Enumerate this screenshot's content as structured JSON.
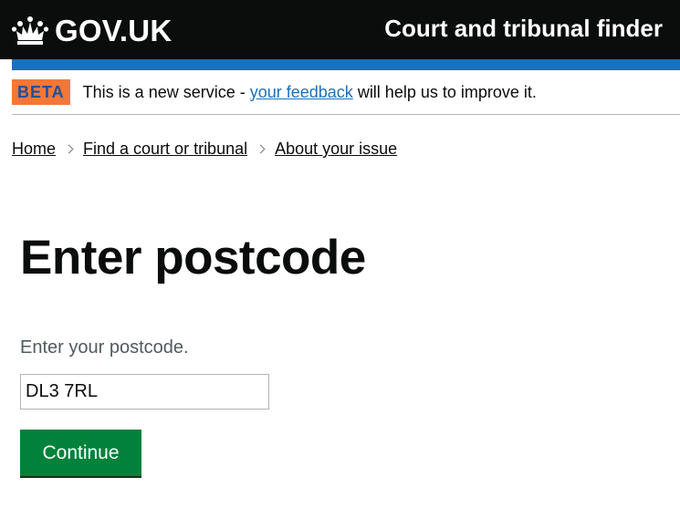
{
  "header": {
    "logo_text": "GOV.UK",
    "service_name": "Court and tribunal finder"
  },
  "phase_banner": {
    "tag": "BETA",
    "text_before": "This is a new service - ",
    "link_text": "your feedback",
    "text_after": " will help us to improve it."
  },
  "breadcrumbs": [
    {
      "label": "Home"
    },
    {
      "label": "Find a court or tribunal"
    },
    {
      "label": "About your issue"
    }
  ],
  "main": {
    "title": "Enter postcode",
    "postcode_label": "Enter your postcode.",
    "postcode_value": "DL3 7RL",
    "continue_label": "Continue"
  },
  "colors": {
    "header_bg": "#0b0c0c",
    "header_bar": "#1d70b8",
    "beta_tag": "#f47738",
    "link": "#1d70b8",
    "button": "#00823b"
  },
  "icons": {
    "logo": "crown-icon",
    "breadcrumb_separator": "chevron-right-icon"
  }
}
